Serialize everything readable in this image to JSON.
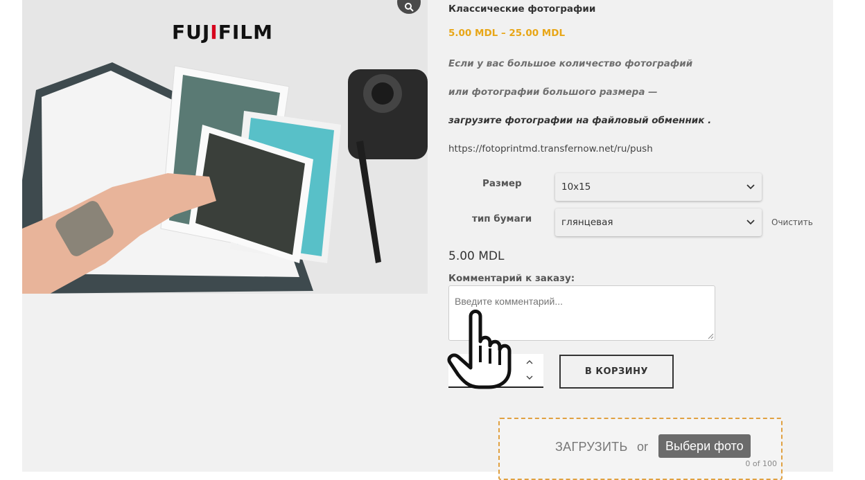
{
  "product": {
    "title": "Классические фотографии",
    "price_range": "5.00 MDL – 25.00 MDL",
    "brand_logo_text": "FUJIFILM",
    "notes": [
      "Если у вас большое количество фотографий",
      "или фотографии большого размера —",
      "загрузите фотографии на файловый обменник ."
    ],
    "upload_link": "https://fotoprintmd.transfernow.net/ru/push"
  },
  "options": {
    "size_label": "Размер",
    "size_value": "10x15",
    "paper_label": "тип бумаги",
    "paper_value": "глянцевая",
    "clear_label": "Очистить"
  },
  "order": {
    "unit_price": "5.00 MDL",
    "comment_label": "Комментарий к заказу:",
    "comment_placeholder": "Введите комментарий...",
    "quantity": "",
    "add_to_cart_label": "В КОРЗИНУ"
  },
  "upload": {
    "label": "ЗАГРУЗИТЬ",
    "or_label": "or",
    "choose_label": "Выбери фото",
    "count": "0 of 100"
  },
  "icons": {
    "zoom": "magnifier-icon",
    "select_arrow": "chevron-down-icon",
    "qty_up": "chevron-up-icon",
    "qty_down": "chevron-down-icon",
    "cursor": "hand-pointer-icon"
  },
  "colors": {
    "price_accent": "#e8a617",
    "upload_border": "#e0a040",
    "brand_accent": "#d6001c"
  }
}
